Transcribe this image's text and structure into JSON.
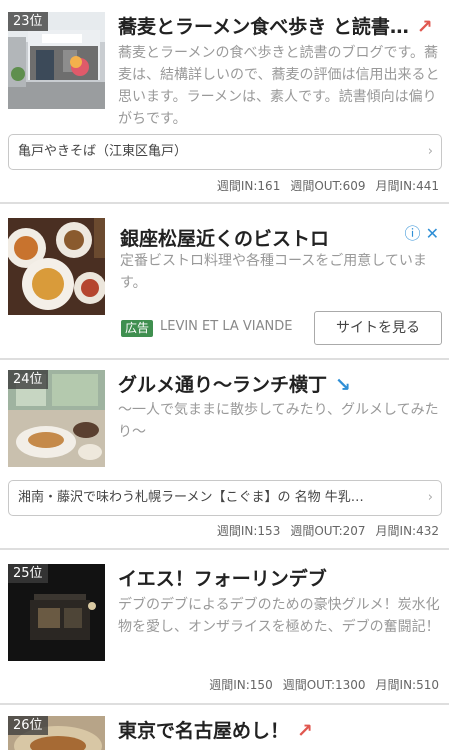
{
  "items": [
    {
      "rank": "23位",
      "title": "蕎麦とラーメン食べ歩き と読書…",
      "trend": "↗",
      "desc": "蕎麦とラーメンの食べ歩きと読書のブログです。蕎麦は、結構詳しいので、蕎麦の評価は信用出来ると思います。ラーメンは、素人です。読書傾向は偏りがちです。",
      "link": "亀戸やきそば（江東区亀戸）",
      "stats": [
        "週間IN:161",
        "週間OUT:609",
        "月間IN:441"
      ]
    },
    {
      "rank": "24位",
      "title": "グルメ通り〜ランチ横丁",
      "trend": "↘",
      "desc": "〜一人で気ままに散歩してみたり、グルメしてみたり〜",
      "link": "湘南・藤沢で味わう札幌ラーメン【こぐま】の 名物 牛乳…",
      "stats": [
        "週間IN:153",
        "週間OUT:207",
        "月間IN:432"
      ]
    },
    {
      "rank": "25位",
      "title": "イエス！フォーリンデブ",
      "desc": "デブのデブによるデブのための豪快グルメ！炭水化物を愛し、オンザライスを極めた、デブの奮闘記！",
      "stats": [
        "週間IN:150",
        "週間OUT:1300",
        "月間IN:510"
      ]
    },
    {
      "rank": "26位",
      "title": "東京で名古屋めし！",
      "trend": "↗"
    }
  ],
  "ad": {
    "title": "銀座松屋近くのビストロ",
    "desc": "定番ビストロ料理や各種コースをご用意しています。",
    "badge": "広告",
    "advertiser": "LEVIN ET LA VIANDE",
    "button": "サイトを見る",
    "info_icon": "ⓘ",
    "close_icon": "✕"
  },
  "chevron": "›"
}
